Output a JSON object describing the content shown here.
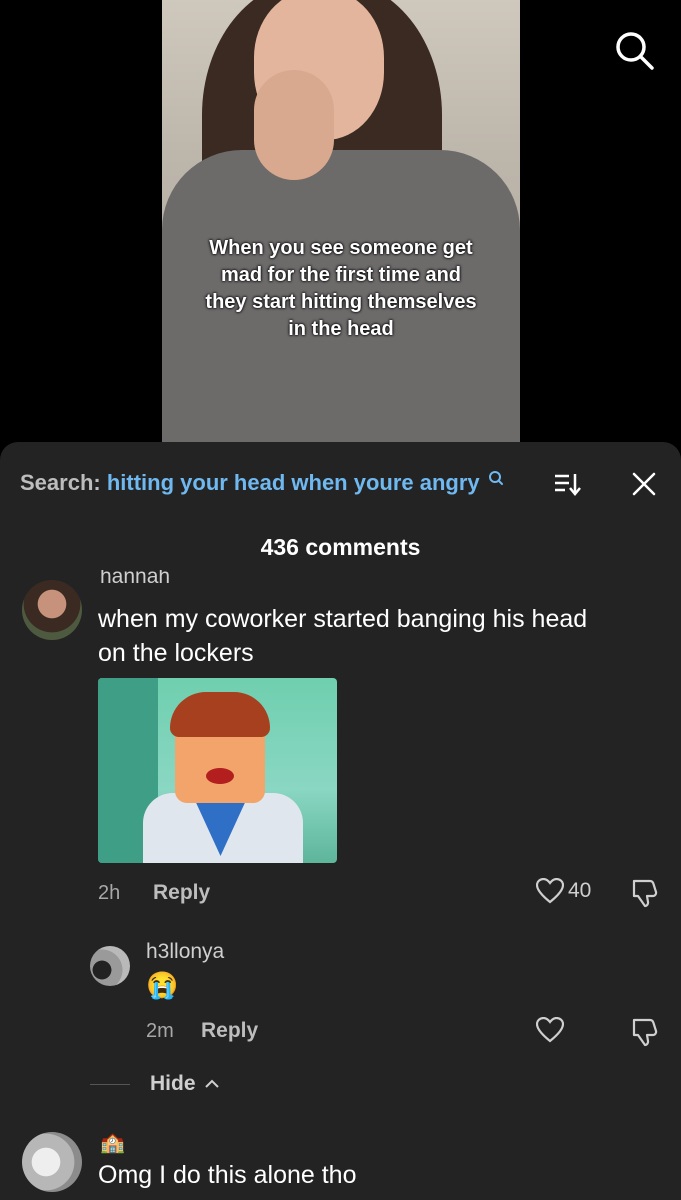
{
  "video": {
    "caption_lines": [
      "When you see someone get",
      "mad for the first time and",
      "they start hitting themselves",
      "in the head"
    ]
  },
  "comments_sheet": {
    "search_prefix": "Search:",
    "search_query": "hitting your head when youre angry",
    "count_label": "436 comments"
  },
  "comments": [
    {
      "username": "hannah",
      "text_lines": [
        "when my coworker started banging his head",
        "on the lockers"
      ],
      "time": "2h",
      "reply_label": "Reply",
      "likes": "40"
    },
    {
      "username": "h3llonya",
      "emoji": "😭",
      "time": "2m",
      "reply_label": "Reply"
    },
    {
      "username_emoji": "🏫",
      "text": "Omg I do this alone tho"
    }
  ],
  "hide_label": "Hide",
  "colors": {
    "accent": "#6fb8f0",
    "sheet_bg": "#232323"
  }
}
